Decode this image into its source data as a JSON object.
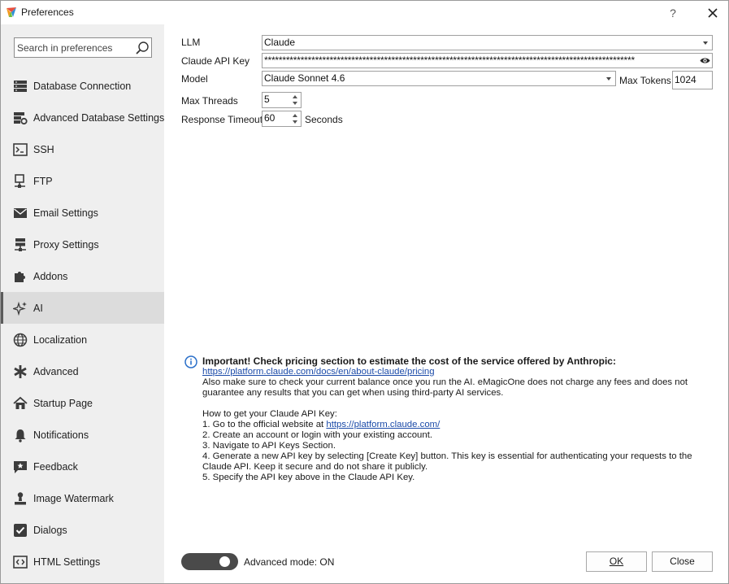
{
  "window": {
    "title": "Preferences",
    "help_glyph": "?"
  },
  "sidebar": {
    "search_placeholder": "Search in preferences",
    "items": [
      {
        "label": "Database Connection",
        "icon": "database-icon",
        "active": false
      },
      {
        "label": "Advanced Database Settings",
        "icon": "database-settings-icon",
        "active": false
      },
      {
        "label": "SSH",
        "icon": "terminal-icon",
        "active": false
      },
      {
        "label": "FTP",
        "icon": "ftp-icon",
        "active": false
      },
      {
        "label": "Email Settings",
        "icon": "envelope-icon",
        "active": false
      },
      {
        "label": "Proxy Settings",
        "icon": "proxy-icon",
        "active": false
      },
      {
        "label": "Addons",
        "icon": "puzzle-icon",
        "active": false
      },
      {
        "label": "AI",
        "icon": "sparkle-icon",
        "active": true
      },
      {
        "label": "Localization",
        "icon": "globe-icon",
        "active": false
      },
      {
        "label": "Advanced",
        "icon": "asterisk-icon",
        "active": false
      },
      {
        "label": "Startup Page",
        "icon": "home-icon",
        "active": false
      },
      {
        "label": "Notifications",
        "icon": "bell-icon",
        "active": false
      },
      {
        "label": "Feedback",
        "icon": "feedback-icon",
        "active": false
      },
      {
        "label": "Image Watermark",
        "icon": "person-stamp-icon",
        "active": false
      },
      {
        "label": "Dialogs",
        "icon": "checkbox-icon",
        "active": false
      },
      {
        "label": "HTML Settings",
        "icon": "code-icon",
        "active": false
      }
    ]
  },
  "form": {
    "llm_label": "LLM",
    "llm_value": "Claude",
    "api_key_label": "Claude API Key",
    "api_key_value": "******************************************************************************************************",
    "model_label": "Model",
    "model_value": "Claude Sonnet 4.6",
    "max_tokens_label": "Max Tokens",
    "max_tokens_value": "1024",
    "max_threads_label": "Max Threads",
    "max_threads_value": "5",
    "timeout_label": "Response Timeout",
    "timeout_value": "60",
    "timeout_unit": "Seconds"
  },
  "info": {
    "heading": "Important! Check pricing section to estimate the cost of the service offered by Anthropic:",
    "pricing_link": "https://platform.claude.com/docs/en/about-claude/pricing",
    "balance_note": "Also make sure to check your current balance once you run the AI. eMagicOne does not charge any fees and does not guarantee any results that you can get when using third-party AI services.",
    "howto_title": "How to get your Claude API Key:",
    "step1_prefix": "1. Go to the official website at ",
    "step1_link": "https://platform.claude.com/",
    "step2": "2. Create an account or login with your existing account.",
    "step3": "3. Navigate to API Keys Section.",
    "step4": "4. Generate a new API key by selecting [Create Key] button. This key is essential for authenticating your requests to the Claude API. Keep it secure and do not share it publicly.",
    "step5": "5. Specify the API key above in the Claude API Key."
  },
  "footer": {
    "advanced_mode_label": "Advanced mode: ON",
    "advanced_mode_on": true,
    "ok_label": "OK",
    "close_label": "Close"
  }
}
